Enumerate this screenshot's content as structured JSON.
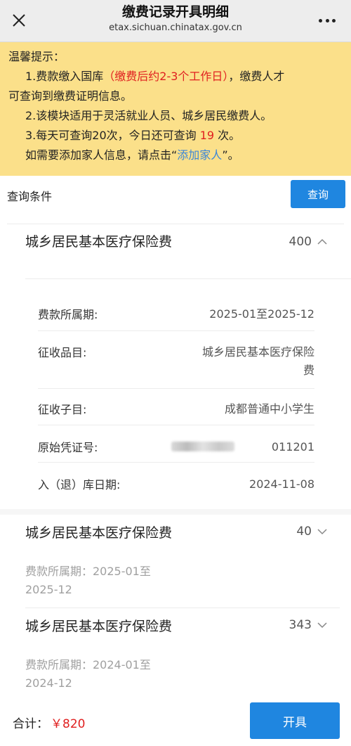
{
  "header": {
    "title": "缴费记录开具明细",
    "url": "etax.sichuan.chinatax.gov.cn"
  },
  "notice": {
    "heading": "温馨提示：",
    "line1_prefix": "1.费款缴入国库",
    "line1_red": "（缴费后约2-3个工作日）",
    "line1_suffix": "，缴费人才",
    "line1_cont": "可查询到缴费证明信息。",
    "line2": "2.该模块适用于灵活就业人员、城乡居民缴费人。",
    "line3_prefix": "3.每天可查询20次，今日还可查询 ",
    "line3_count": "19",
    "line3_suffix": " 次。",
    "line4_prefix": "如需要添加家人信息，请点击“",
    "line4_link": "添加家人",
    "line4_suffix": "”。"
  },
  "query": {
    "label": "查询条件",
    "button": "查询"
  },
  "records": [
    {
      "title": "城乡居民基本医疗保险费",
      "amount": "400",
      "expanded": true,
      "details": {
        "period_label": "费款所属期:",
        "period_value": "2025-01至2025-12",
        "item_label": "征收品目:",
        "item_value_1": "城乡居民基本医疗保险",
        "item_value_2": "费",
        "subitem_label": "征收子目:",
        "subitem_value": "成都普通中小学生",
        "voucher_label": "原始凭证号:",
        "voucher_value_visible": "011201",
        "date_label": "入（退）库日期:",
        "date_value": "2024-11-08"
      }
    },
    {
      "title": "城乡居民基本医疗保险费",
      "amount": "40",
      "expanded": false,
      "period_line1": "费款所属期：2025-01至",
      "period_line2": "2025-12"
    },
    {
      "title": "城乡居民基本医疗保险费",
      "amount": "343",
      "expanded": false,
      "period_line1": "费款所属期：2024-01至",
      "period_line2": "2024-12"
    }
  ],
  "footer": {
    "total_label": "合计：",
    "total_amount": "￥820",
    "issue_button": "开具"
  },
  "colors": {
    "notice_bg": "#fbe08a",
    "accent_blue": "#1f86e0",
    "highlight_red": "#e02020",
    "link_blue": "#3b86d8"
  }
}
